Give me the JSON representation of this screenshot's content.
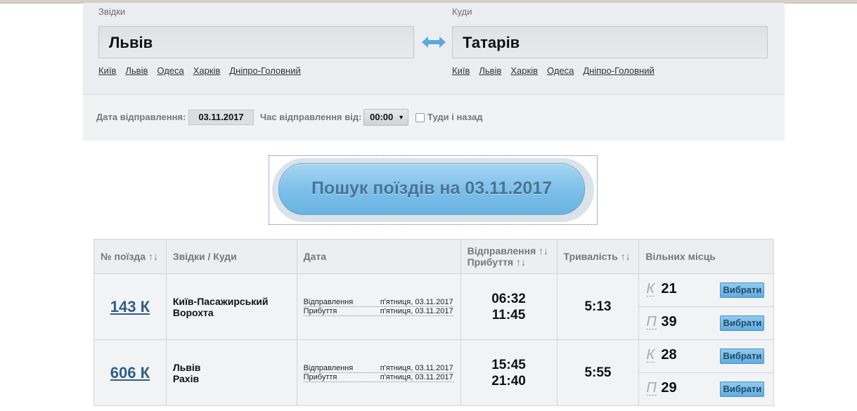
{
  "search": {
    "from_label": "Звідки",
    "to_label": "Куди",
    "from_value": "Львів",
    "to_value": "Татарів",
    "from_links": [
      "Київ",
      "Львів",
      "Одеса",
      "Харків",
      "Дніпро-Головний"
    ],
    "to_links": [
      "Київ",
      "Львів",
      "Харків",
      "Одеса",
      "Дніпро-Головний"
    ],
    "swap_icon": "swap-arrows-icon"
  },
  "options": {
    "date_label": "Дата відправлення:",
    "date_value": "03.11.2017",
    "time_label": "Час відправлення від:",
    "time_value": "00:00",
    "roundtrip_label": "Туди і назад",
    "roundtrip_checked": false
  },
  "search_button": "Пошук поїздів на 03.11.2017",
  "table": {
    "headers": {
      "num": "№ поїзда ↑↓",
      "route": "Звідки / Куди",
      "date": "Дата",
      "dep_line": "Відправлення ↑↓",
      "arr_line": "Прибуття ↑↓",
      "duration": "Тривалість ↑↓",
      "seats": "Вільних місць"
    },
    "rows": [
      {
        "num": "143 К",
        "from": "Київ-Пасажирський",
        "to": "Ворохта",
        "dep_label": "Відправлення",
        "dep_date": "п'ятниця, 03.11.2017",
        "arr_label": "Прибуття",
        "arr_date": "п'ятниця, 03.11.2017",
        "dep_time": "06:32",
        "arr_time": "11:45",
        "duration": "5:13",
        "seats": [
          {
            "type": "К",
            "count": "21",
            "button": "Вибрати"
          },
          {
            "type": "П",
            "count": "39",
            "button": "Вибрати"
          }
        ]
      },
      {
        "num": "606 К",
        "from": "Львів",
        "to": "Рахів",
        "dep_label": "Відправлення",
        "dep_date": "п'ятниця, 03.11.2017",
        "arr_label": "Прибуття",
        "arr_date": "п'ятниця, 03.11.2017",
        "dep_time": "15:45",
        "arr_time": "21:40",
        "duration": "5:55",
        "seats": [
          {
            "type": "К",
            "count": "28",
            "button": "Вибрати"
          },
          {
            "type": "П",
            "count": "29",
            "button": "Вибрати"
          }
        ]
      }
    ]
  },
  "colors": {
    "accent": "#7ec0ea",
    "link": "#2f5f86",
    "panel": "#ebedf0"
  }
}
